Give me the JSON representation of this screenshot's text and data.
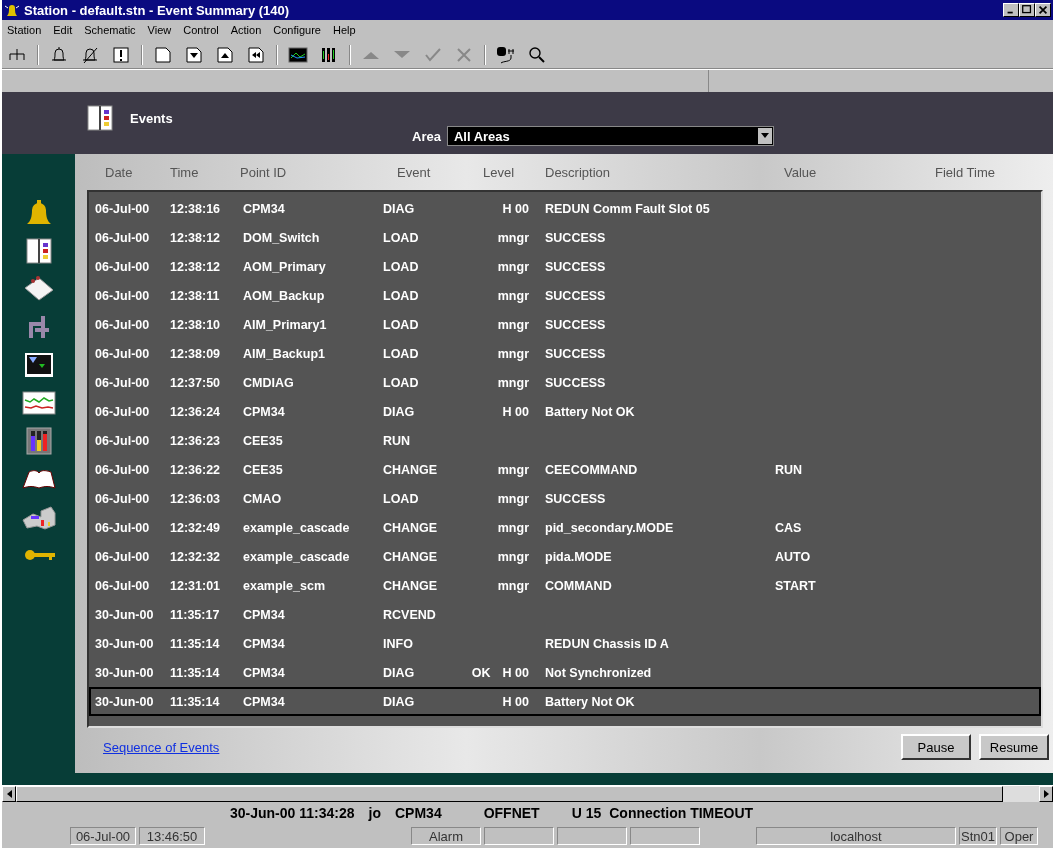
{
  "window": {
    "title": "Station - default.stn - Event Summary (140)"
  },
  "menu": [
    "Station",
    "Edit",
    "Schematic",
    "View",
    "Control",
    "Action",
    "Configure",
    "Help"
  ],
  "header": {
    "title": "Events",
    "area_label": "Area",
    "area_value": "All Areas"
  },
  "table": {
    "columns": [
      "Date",
      "Time",
      "Point ID",
      "Event",
      "Level",
      "Description",
      "Value",
      "Field Time"
    ],
    "rows": [
      {
        "date": "06-Jul-00",
        "time": "12:38:16",
        "point": "CPM34",
        "event": "DIAG",
        "flag": "",
        "level": "H 00",
        "description": "REDUN Comm Fault Slot 05",
        "value": "",
        "selected": false
      },
      {
        "date": "06-Jul-00",
        "time": "12:38:12",
        "point": "DOM_Switch",
        "event": "LOAD",
        "flag": "",
        "level": "mngr",
        "description": "SUCCESS",
        "value": "",
        "selected": false
      },
      {
        "date": "06-Jul-00",
        "time": "12:38:12",
        "point": "AOM_Primary",
        "event": "LOAD",
        "flag": "",
        "level": "mngr",
        "description": "SUCCESS",
        "value": "",
        "selected": false
      },
      {
        "date": "06-Jul-00",
        "time": "12:38:11",
        "point": "AOM_Backup",
        "event": "LOAD",
        "flag": "",
        "level": "mngr",
        "description": "SUCCESS",
        "value": "",
        "selected": false
      },
      {
        "date": "06-Jul-00",
        "time": "12:38:10",
        "point": "AIM_Primary1",
        "event": "LOAD",
        "flag": "",
        "level": "mngr",
        "description": "SUCCESS",
        "value": "",
        "selected": false
      },
      {
        "date": "06-Jul-00",
        "time": "12:38:09",
        "point": "AIM_Backup1",
        "event": "LOAD",
        "flag": "",
        "level": "mngr",
        "description": "SUCCESS",
        "value": "",
        "selected": false
      },
      {
        "date": "06-Jul-00",
        "time": "12:37:50",
        "point": "CMDIAG",
        "event": "LOAD",
        "flag": "",
        "level": "mngr",
        "description": "SUCCESS",
        "value": "",
        "selected": false
      },
      {
        "date": "06-Jul-00",
        "time": "12:36:24",
        "point": "CPM34",
        "event": "DIAG",
        "flag": "",
        "level": "H 00",
        "description": "Battery Not OK",
        "value": "",
        "selected": false
      },
      {
        "date": "06-Jul-00",
        "time": "12:36:23",
        "point": "CEE35",
        "event": "RUN",
        "flag": "",
        "level": "",
        "description": "",
        "value": "",
        "selected": false
      },
      {
        "date": "06-Jul-00",
        "time": "12:36:22",
        "point": "CEE35",
        "event": "CHANGE",
        "flag": "",
        "level": "mngr",
        "description": "CEECOMMAND",
        "value": "RUN",
        "selected": false
      },
      {
        "date": "06-Jul-00",
        "time": "12:36:03",
        "point": "CMAO",
        "event": "LOAD",
        "flag": "",
        "level": "mngr",
        "description": "SUCCESS",
        "value": "",
        "selected": false
      },
      {
        "date": "06-Jul-00",
        "time": "12:32:49",
        "point": "example_cascade",
        "event": "CHANGE",
        "flag": "",
        "level": "mngr",
        "description": "pid_secondary.MODE",
        "value": "CAS",
        "selected": false
      },
      {
        "date": "06-Jul-00",
        "time": "12:32:32",
        "point": "example_cascade",
        "event": "CHANGE",
        "flag": "",
        "level": "mngr",
        "description": "pida.MODE",
        "value": "AUTO",
        "selected": false
      },
      {
        "date": "06-Jul-00",
        "time": "12:31:01",
        "point": "example_scm",
        "event": "CHANGE",
        "flag": "",
        "level": "mngr",
        "description": "COMMAND",
        "value": "START",
        "selected": false
      },
      {
        "date": "30-Jun-00",
        "time": "11:35:17",
        "point": "CPM34",
        "event": "RCVEND",
        "flag": "",
        "level": "",
        "description": "",
        "value": "",
        "selected": false
      },
      {
        "date": "30-Jun-00",
        "time": "11:35:14",
        "point": "CPM34",
        "event": "INFO",
        "flag": "",
        "level": "",
        "description": "REDUN Chassis ID A",
        "value": "",
        "selected": false
      },
      {
        "date": "30-Jun-00",
        "time": "11:35:14",
        "point": "CPM34",
        "event": "DIAG",
        "flag": "OK",
        "level": "H 00",
        "description": "Not Synchronized",
        "value": "",
        "selected": false
      },
      {
        "date": "30-Jun-00",
        "time": "11:35:14",
        "point": "CPM34",
        "event": "DIAG",
        "flag": "",
        "level": "H 00",
        "description": "Battery Not OK",
        "value": "",
        "selected": true
      }
    ]
  },
  "footer": {
    "link": "Sequence of Events",
    "buttons": [
      "Pause",
      "Resume"
    ]
  },
  "message_line": [
    "30-Jun-00 11:34:28",
    "jo",
    "CPM34",
    "OFFNET",
    "U 15",
    "Connection TIMEOUT"
  ],
  "status_bar": {
    "left": [
      "06-Jul-00",
      "13:46:50"
    ],
    "middle": [
      "Alarm"
    ],
    "right": [
      "localhost",
      "Stn01",
      "Oper"
    ]
  }
}
